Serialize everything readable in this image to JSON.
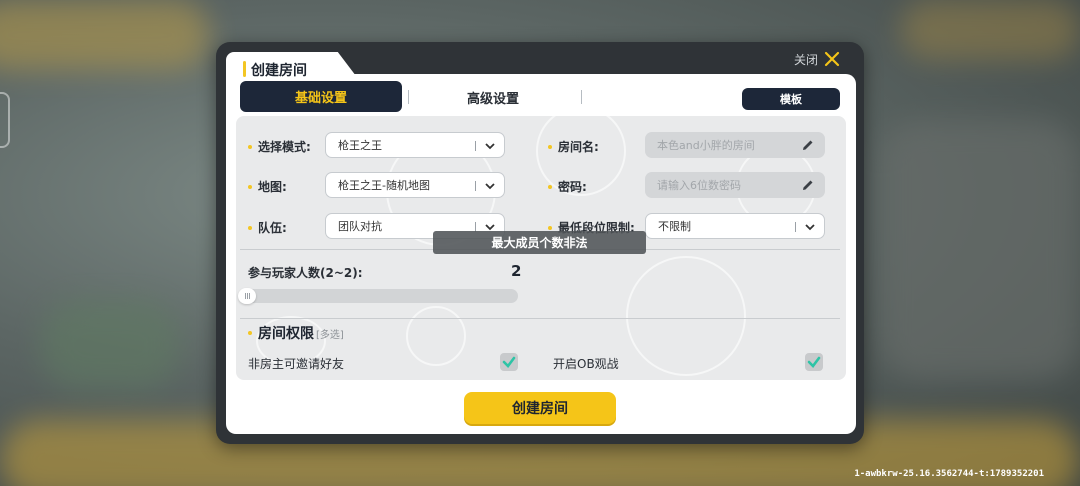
{
  "dialog": {
    "title": "创建房间",
    "close_label": "关闭",
    "tabs": [
      {
        "label": "基础设置",
        "active": true
      },
      {
        "label": "高级设置",
        "active": false
      }
    ],
    "template_label": "模板"
  },
  "form": {
    "mode": {
      "label": "选择模式:",
      "value": "枪王之王"
    },
    "map": {
      "label": "地图:",
      "value": "枪王之王-随机地图"
    },
    "team": {
      "label": "队伍:",
      "value": "团队对抗"
    },
    "room_name": {
      "label": "房间名:",
      "placeholder": "本色and小胖的房间"
    },
    "password": {
      "label": "密码:",
      "placeholder": "请输入6位数密码"
    },
    "min_rank": {
      "label": "最低段位限制:",
      "value": "不限制"
    },
    "players": {
      "label": "参与玩家人数(2~2):",
      "value": "2"
    }
  },
  "toast": "最大成员个数非法",
  "permissions": {
    "title": "房间权限",
    "subtitle": "[多选]",
    "items": [
      {
        "label": "非房主可邀请好友",
        "checked": true
      },
      {
        "label": "开启OB观战",
        "checked": true
      }
    ]
  },
  "create_button": "创建房间",
  "build_id": "1-awbkrw-25.16.3562744-t:1789352201",
  "colors": {
    "accent_yellow": "#f5c518",
    "navy": "#1d2739",
    "check_teal": "#2ec4a6"
  }
}
